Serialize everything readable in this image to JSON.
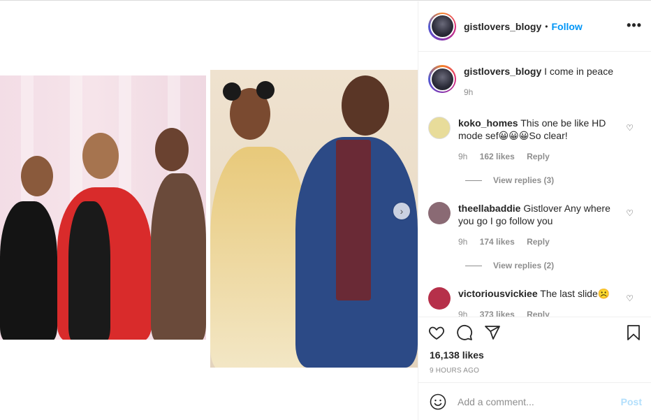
{
  "post": {
    "author": "gistlovers_blogy",
    "follow_label": "Follow",
    "dot": "•",
    "more_label": "•••",
    "next_label": "›"
  },
  "caption": {
    "username": "gistlovers_blogy",
    "text": "I come in peace",
    "time": "9h"
  },
  "comments": [
    {
      "username": "koko_homes",
      "text": "This one be like HD mode sef😀😀😀So clear!",
      "time": "9h",
      "likes": "162 likes",
      "reply": "Reply",
      "view_replies": "View replies (3)",
      "avatar_color": "#e8dc9a"
    },
    {
      "username": "theellabaddie",
      "text": "Gistlover Any where you go I go follow you",
      "time": "9h",
      "likes": "174 likes",
      "reply": "Reply",
      "view_replies": "View replies (2)",
      "avatar_color": "#8a6a74"
    },
    {
      "username": "victoriousvickiee",
      "text": "The last slide☹️",
      "time": "9h",
      "likes": "373 likes",
      "reply": "Reply",
      "avatar_color": "#b6304a"
    }
  ],
  "actions": {
    "likes": "16,138 likes",
    "timestamp": "9 HOURS AGO"
  },
  "add_comment": {
    "placeholder": "Add a comment...",
    "post_label": "Post"
  },
  "colors": {
    "accent": "#0095f6",
    "post_disabled": "#b2dffc",
    "muted": "#8e8e8e"
  },
  "icons": [
    "heart-icon",
    "comment-icon",
    "share-icon",
    "bookmark-icon",
    "emoji-icon",
    "more-icon",
    "chevron-right-icon"
  ]
}
